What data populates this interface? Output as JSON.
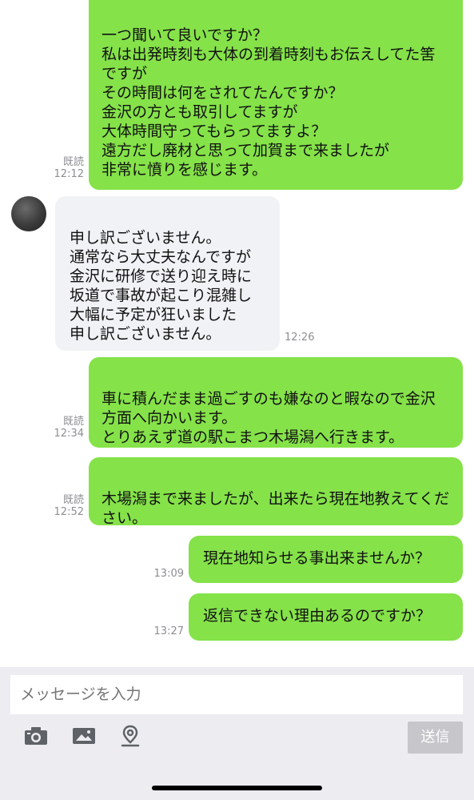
{
  "messages": [
    {
      "side": "out",
      "text": "一つ聞いて良いですか？\n私は出発時刻も大体の到着時刻もお伝えしてた筈ですが\nその時間は何をされてたんですか？\n金沢の方とも取引してますが\n大体時間守ってもらってますよ？\n遠方だし廃材と思って加賀まで来ましたが\n非常に憤りを感じます。",
      "read": "既読",
      "time": "12:12"
    },
    {
      "side": "in",
      "text": "申し訳ございません。\n通常なら大丈夫なんですが\n金沢に研修で送り迎え時に\n坂道で事故が起こり混雑し\n大幅に予定が狂いました\n申し訳ございません。",
      "time": "12:26"
    },
    {
      "side": "out",
      "text": "車に積んだまま過ごすのも嫌なのと暇なので金沢方面へ向かいます。\nとりあえず道の駅こまつ木場潟へ行きます。",
      "read": "既読",
      "time": "12:34"
    },
    {
      "side": "out",
      "text": "木場潟まで来ましたが、出来たら現在地教えてください。",
      "read": "既読",
      "time": "12:52"
    },
    {
      "side": "out",
      "text": "現在地知らせる事出来ませんか？",
      "time": "13:09"
    },
    {
      "side": "out",
      "text": "返信できない理由あるのですか？",
      "time": "13:27"
    }
  ],
  "composer": {
    "placeholder": "メッセージを入力",
    "send_label": "送信",
    "icons": [
      "camera-icon",
      "image-icon",
      "location-icon"
    ]
  },
  "colors": {
    "outgoing_bubble": "#85e249",
    "incoming_bubble": "#f1f2f6",
    "meta_text": "#8e8e93",
    "composer_bg": "#ededf1",
    "send_disabled": "#c6c6cb"
  }
}
